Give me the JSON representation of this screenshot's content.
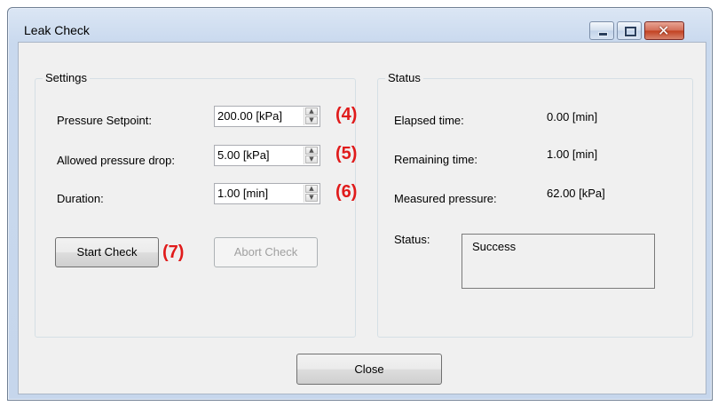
{
  "window": {
    "title": "Leak Check",
    "caption_buttons": {
      "minimize_icon": "minimize-icon",
      "maximize_icon": "maximize-icon",
      "close_glyph": "✕"
    }
  },
  "settings": {
    "group_title": "Settings",
    "pressure_setpoint": {
      "label": "Pressure Setpoint:",
      "value": "200.00 [kPa]",
      "callout": "(4)"
    },
    "allowed_pressure_drop": {
      "label": "Allowed pressure drop:",
      "value": "5.00 [kPa]",
      "callout": "(5)"
    },
    "duration": {
      "label": "Duration:",
      "value": "1.00 [min]",
      "callout": "(6)"
    },
    "spin_up_glyph": "▲",
    "spin_down_glyph": "▼",
    "start_check_label": "Start Check",
    "start_callout": "(7)",
    "abort_check_label": "Abort Check"
  },
  "status": {
    "group_title": "Status",
    "elapsed_time": {
      "label": "Elapsed time:",
      "value": "0.00 [min]"
    },
    "remaining_time": {
      "label": "Remaining time:",
      "value": "1.00 [min]"
    },
    "measured_pressure": {
      "label": "Measured pressure:",
      "value": "62.00 [kPa]"
    },
    "status_label": "Status:",
    "status_value": "Success"
  },
  "footer": {
    "close_label": "Close"
  },
  "colors": {
    "callout": "#e01b1b",
    "titlebar": "#c9d9ee",
    "client": "#f0f0f0"
  }
}
